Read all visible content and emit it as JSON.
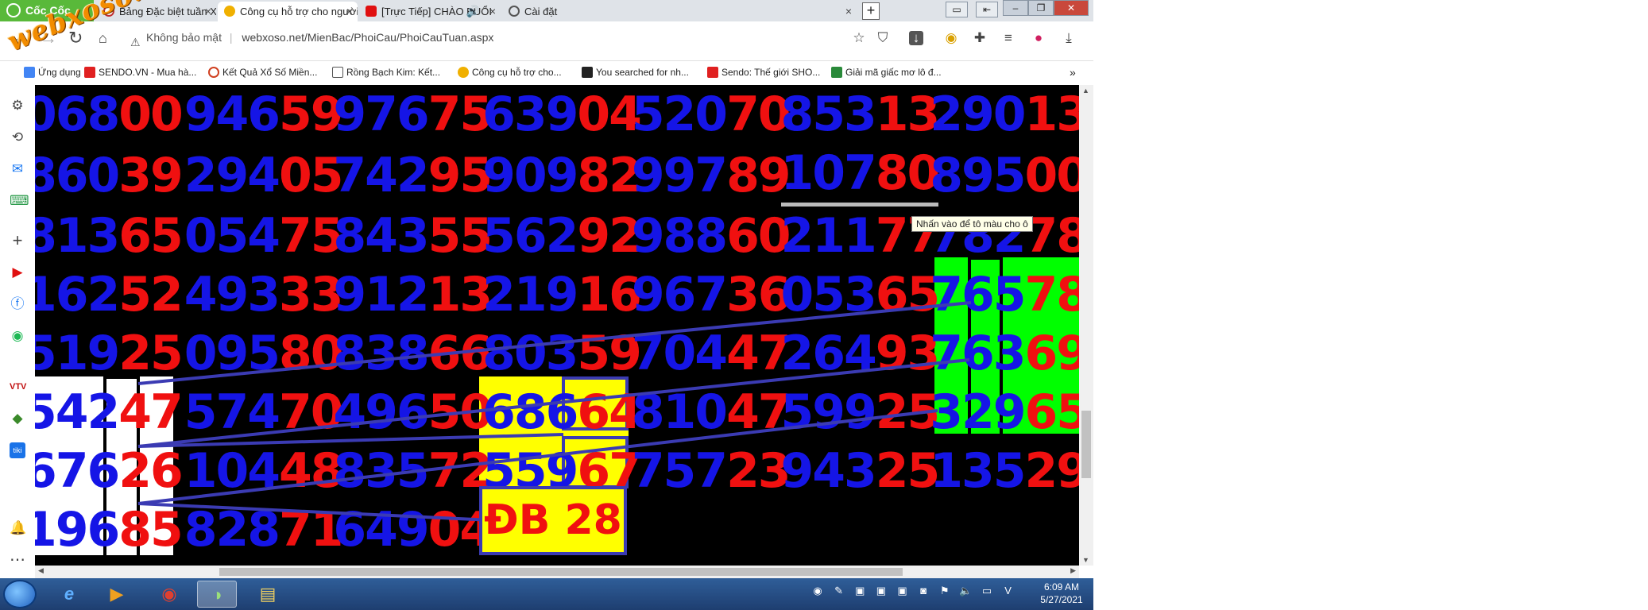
{
  "browser": {
    "brand": "Cốc Cốc",
    "tabs": [
      {
        "title": "Bảng Đặc biệt tuần Xổ Số Trực",
        "icon": "webxoso-icon",
        "active": false
      },
      {
        "title": "Công cụ hỗ trợ cho người chơi",
        "icon": "xs-icon",
        "active": true
      },
      {
        "title": "[Trực Tiếp] CHÀO BUỔI",
        "icon": "youtube-icon",
        "active": false
      },
      {
        "title": "Cài đặt",
        "icon": "gear-icon",
        "active": false
      }
    ],
    "new_tab": "+",
    "security_label": "Không bảo mật",
    "url": "webxoso.net/MienBac/PhoiCau/PhoiCauTuan.aspx",
    "bookmarks": [
      {
        "label": "Ứng dụng",
        "color": "#4285f4"
      },
      {
        "label": "SENDO.VN - Mua hà...",
        "color": "#e02020"
      },
      {
        "label": "Kết Quả Xổ Số Miền...",
        "color": "#d04020"
      },
      {
        "label": "Rồng Bạch Kim: Kết...",
        "color": "#555555"
      },
      {
        "label": "Công cụ hỗ trợ cho...",
        "color": "#f0b000"
      },
      {
        "label": "You searched for nh...",
        "color": "#222222"
      },
      {
        "label": "Sendo: Thế giới SHO...",
        "color": "#e02020"
      },
      {
        "label": "Giải mã giấc mơ lô đ...",
        "color": "#2a8a3a"
      }
    ],
    "more_bookmarks": "»"
  },
  "watermark": "webxoso.net",
  "grid": {
    "rows": [
      [
        [
          "068",
          "00"
        ],
        [
          "946",
          "59"
        ],
        [
          "976",
          "75"
        ],
        [
          "639",
          "04"
        ],
        [
          "520",
          "70"
        ],
        [
          "853",
          "13"
        ],
        [
          "290",
          "13"
        ]
      ],
      [
        [
          "860",
          "39"
        ],
        [
          "294",
          "05"
        ],
        [
          "742",
          "95"
        ],
        [
          "909",
          "82"
        ],
        [
          "997",
          "89"
        ],
        [
          "107",
          "80"
        ],
        [
          "895",
          "00"
        ]
      ],
      [
        [
          "813",
          "65"
        ],
        [
          "054",
          "75"
        ],
        [
          "843",
          "55"
        ],
        [
          "562",
          "92"
        ],
        [
          "988",
          "60"
        ],
        [
          "211",
          "77"
        ],
        [
          "782",
          "78"
        ]
      ],
      [
        [
          "162",
          "52"
        ],
        [
          "493",
          "33"
        ],
        [
          "912",
          "13"
        ],
        [
          "219",
          "16"
        ],
        [
          "967",
          "36"
        ],
        [
          "053",
          "65"
        ],
        [
          "765",
          "78"
        ]
      ],
      [
        [
          "519",
          "25"
        ],
        [
          "095",
          "80"
        ],
        [
          "838",
          "66"
        ],
        [
          "803",
          "59"
        ],
        [
          "704",
          "47"
        ],
        [
          "264",
          "93"
        ],
        [
          "763",
          "69"
        ]
      ],
      [
        [
          "542",
          "47"
        ],
        [
          "574",
          "70"
        ],
        [
          "496",
          "50"
        ],
        [
          "686",
          "64"
        ],
        [
          "810",
          "47"
        ],
        [
          "599",
          "25"
        ],
        [
          "329",
          "65"
        ]
      ],
      [
        [
          "676",
          "26"
        ],
        [
          "104",
          "48"
        ],
        [
          "835",
          "72"
        ],
        [
          "559",
          "67"
        ],
        [
          "757",
          "23"
        ],
        [
          "943",
          "25"
        ],
        [
          "135",
          "29"
        ]
      ],
      [
        [
          "196",
          "85"
        ],
        [
          "828",
          "71"
        ],
        [
          "649",
          "04"
        ],
        null,
        null,
        null,
        null
      ]
    ]
  },
  "special": "ĐB 28",
  "tooltip": "Nhấn vào để tô màu cho ô",
  "colors": {
    "blue_digits": "#1515e6",
    "red_digits": "#f01010",
    "yellow_highlight": "#ffff00",
    "green_highlight": "#00ff00",
    "link_line": "#3b3bb3"
  },
  "sidebar": [
    "settings-icon",
    "history-icon",
    "messenger-icon",
    "game-icon",
    "add-icon",
    "youtube-icon",
    "facebook-icon",
    "spotify-icon",
    "vtv-icon",
    "bird-icon",
    "tiki-icon",
    "bell-icon",
    "more-icon"
  ],
  "taskbar": {
    "time": "6:09 AM",
    "date": "5/27/2021"
  }
}
